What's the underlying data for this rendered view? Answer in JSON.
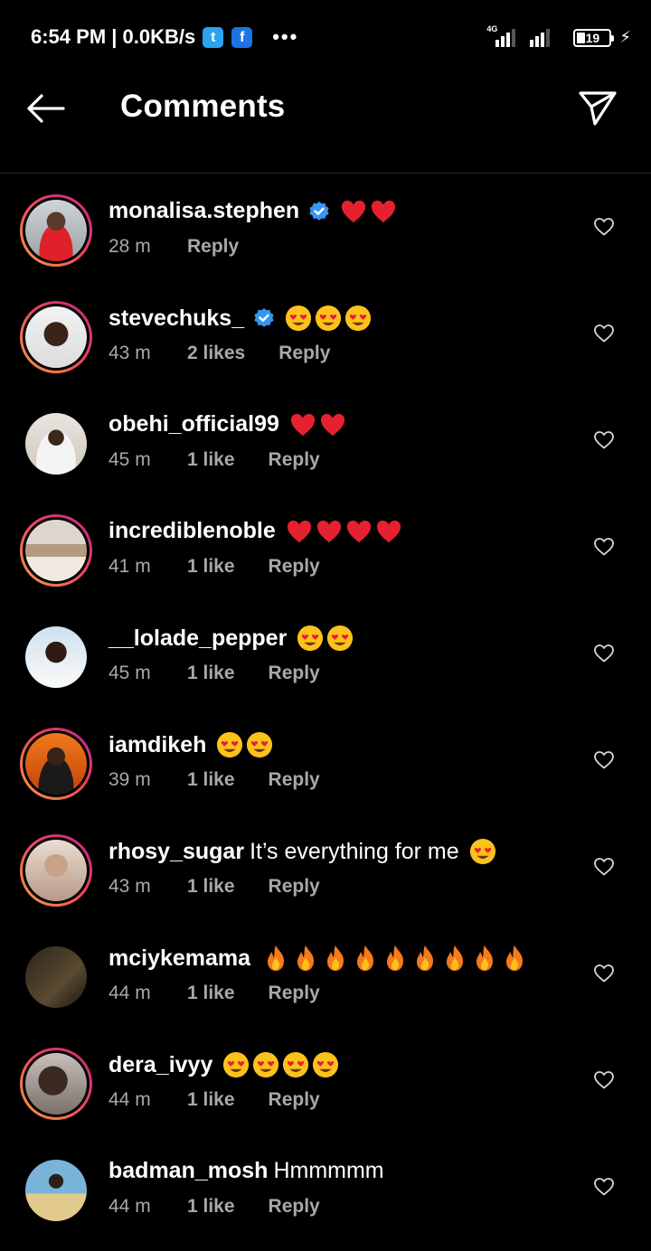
{
  "status_bar": {
    "time": "6:54 PM | 0.0KB/s",
    "network": "4G",
    "battery": "19",
    "twitter_icon": "twitter-icon",
    "facebook_icon": "facebook-icon",
    "overflow": "•••"
  },
  "header": {
    "title": "Comments",
    "back_icon": "arrow-left-icon",
    "share_icon": "send-icon"
  },
  "colors": {
    "background": "#000000",
    "meta_text": "#a8a8a8",
    "verified": "#3797f0",
    "ring_start": "#f9a03e",
    "ring_end": "#c02683"
  },
  "comments": [
    {
      "username": "monalisa.stephen",
      "verified": true,
      "text": "",
      "emoji": "red-heart",
      "emoji_count": 2,
      "time": "28 m",
      "likes": "",
      "reply": "Reply",
      "story_ring": true
    },
    {
      "username": "stevechuks_",
      "verified": true,
      "text": "",
      "emoji": "heart-eyes",
      "emoji_count": 3,
      "time": "43 m",
      "likes": "2 likes",
      "reply": "Reply",
      "story_ring": true
    },
    {
      "username": "obehi_official99",
      "verified": false,
      "text": "",
      "emoji": "red-heart",
      "emoji_count": 2,
      "time": "45 m",
      "likes": "1 like",
      "reply": "Reply",
      "story_ring": false
    },
    {
      "username": "incrediblenoble",
      "verified": false,
      "text": "",
      "emoji": "red-heart",
      "emoji_count": 4,
      "time": "41 m",
      "likes": "1 like",
      "reply": "Reply",
      "story_ring": true
    },
    {
      "username": "__lolade_pepper",
      "verified": false,
      "text": "",
      "emoji": "heart-eyes",
      "emoji_count": 2,
      "time": "45 m",
      "likes": "1 like",
      "reply": "Reply",
      "story_ring": false
    },
    {
      "username": "iamdikeh",
      "verified": false,
      "text": "",
      "emoji": "heart-eyes",
      "emoji_count": 2,
      "time": "39 m",
      "likes": "1 like",
      "reply": "Reply",
      "story_ring": true
    },
    {
      "username": "rhosy_sugar",
      "verified": false,
      "text": "It’s everything for me",
      "emoji": "heart-eyes",
      "emoji_count": 1,
      "time": "43 m",
      "likes": "1 like",
      "reply": "Reply",
      "story_ring": true
    },
    {
      "username": "mciykemama",
      "verified": false,
      "text": "",
      "emoji": "fire",
      "emoji_count": 9,
      "time": "44 m",
      "likes": "1 like",
      "reply": "Reply",
      "story_ring": false
    },
    {
      "username": "dera_ivyy",
      "verified": false,
      "text": "",
      "emoji": "heart-eyes",
      "emoji_count": 4,
      "time": "44 m",
      "likes": "1 like",
      "reply": "Reply",
      "story_ring": true
    },
    {
      "username": "badman_mosh",
      "verified": false,
      "text": "Hmmmmm",
      "emoji": "",
      "emoji_count": 0,
      "time": "44 m",
      "likes": "1 like",
      "reply": "Reply",
      "story_ring": false
    }
  ]
}
